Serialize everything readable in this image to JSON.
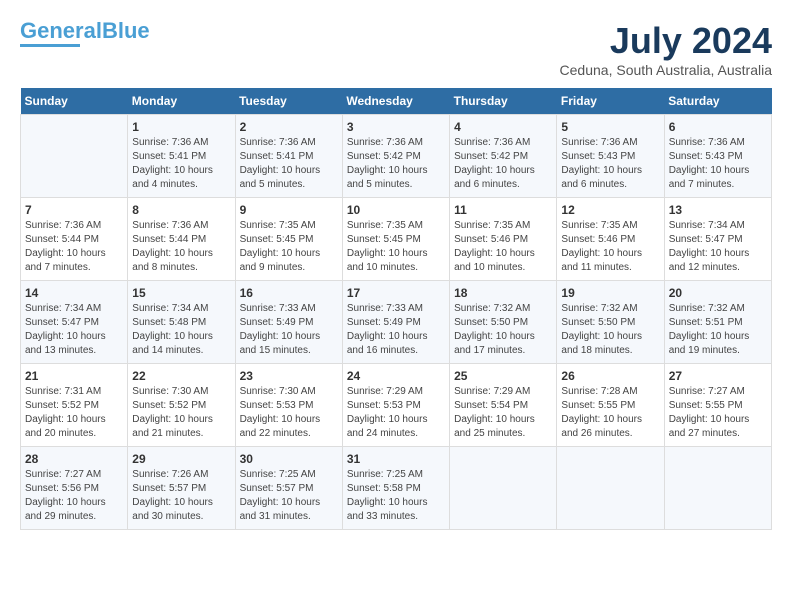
{
  "logo": {
    "general": "General",
    "blue": "Blue"
  },
  "title": "July 2024",
  "location": "Ceduna, South Australia, Australia",
  "days_of_week": [
    "Sunday",
    "Monday",
    "Tuesday",
    "Wednesday",
    "Thursday",
    "Friday",
    "Saturday"
  ],
  "weeks": [
    [
      {
        "day": "",
        "info": ""
      },
      {
        "day": "1",
        "info": "Sunrise: 7:36 AM\nSunset: 5:41 PM\nDaylight: 10 hours\nand 4 minutes."
      },
      {
        "day": "2",
        "info": "Sunrise: 7:36 AM\nSunset: 5:41 PM\nDaylight: 10 hours\nand 5 minutes."
      },
      {
        "day": "3",
        "info": "Sunrise: 7:36 AM\nSunset: 5:42 PM\nDaylight: 10 hours\nand 5 minutes."
      },
      {
        "day": "4",
        "info": "Sunrise: 7:36 AM\nSunset: 5:42 PM\nDaylight: 10 hours\nand 6 minutes."
      },
      {
        "day": "5",
        "info": "Sunrise: 7:36 AM\nSunset: 5:43 PM\nDaylight: 10 hours\nand 6 minutes."
      },
      {
        "day": "6",
        "info": "Sunrise: 7:36 AM\nSunset: 5:43 PM\nDaylight: 10 hours\nand 7 minutes."
      }
    ],
    [
      {
        "day": "7",
        "info": "Sunrise: 7:36 AM\nSunset: 5:44 PM\nDaylight: 10 hours\nand 7 minutes."
      },
      {
        "day": "8",
        "info": "Sunrise: 7:36 AM\nSunset: 5:44 PM\nDaylight: 10 hours\nand 8 minutes."
      },
      {
        "day": "9",
        "info": "Sunrise: 7:35 AM\nSunset: 5:45 PM\nDaylight: 10 hours\nand 9 minutes."
      },
      {
        "day": "10",
        "info": "Sunrise: 7:35 AM\nSunset: 5:45 PM\nDaylight: 10 hours\nand 10 minutes."
      },
      {
        "day": "11",
        "info": "Sunrise: 7:35 AM\nSunset: 5:46 PM\nDaylight: 10 hours\nand 10 minutes."
      },
      {
        "day": "12",
        "info": "Sunrise: 7:35 AM\nSunset: 5:46 PM\nDaylight: 10 hours\nand 11 minutes."
      },
      {
        "day": "13",
        "info": "Sunrise: 7:34 AM\nSunset: 5:47 PM\nDaylight: 10 hours\nand 12 minutes."
      }
    ],
    [
      {
        "day": "14",
        "info": "Sunrise: 7:34 AM\nSunset: 5:47 PM\nDaylight: 10 hours\nand 13 minutes."
      },
      {
        "day": "15",
        "info": "Sunrise: 7:34 AM\nSunset: 5:48 PM\nDaylight: 10 hours\nand 14 minutes."
      },
      {
        "day": "16",
        "info": "Sunrise: 7:33 AM\nSunset: 5:49 PM\nDaylight: 10 hours\nand 15 minutes."
      },
      {
        "day": "17",
        "info": "Sunrise: 7:33 AM\nSunset: 5:49 PM\nDaylight: 10 hours\nand 16 minutes."
      },
      {
        "day": "18",
        "info": "Sunrise: 7:32 AM\nSunset: 5:50 PM\nDaylight: 10 hours\nand 17 minutes."
      },
      {
        "day": "19",
        "info": "Sunrise: 7:32 AM\nSunset: 5:50 PM\nDaylight: 10 hours\nand 18 minutes."
      },
      {
        "day": "20",
        "info": "Sunrise: 7:32 AM\nSunset: 5:51 PM\nDaylight: 10 hours\nand 19 minutes."
      }
    ],
    [
      {
        "day": "21",
        "info": "Sunrise: 7:31 AM\nSunset: 5:52 PM\nDaylight: 10 hours\nand 20 minutes."
      },
      {
        "day": "22",
        "info": "Sunrise: 7:30 AM\nSunset: 5:52 PM\nDaylight: 10 hours\nand 21 minutes."
      },
      {
        "day": "23",
        "info": "Sunrise: 7:30 AM\nSunset: 5:53 PM\nDaylight: 10 hours\nand 22 minutes."
      },
      {
        "day": "24",
        "info": "Sunrise: 7:29 AM\nSunset: 5:53 PM\nDaylight: 10 hours\nand 24 minutes."
      },
      {
        "day": "25",
        "info": "Sunrise: 7:29 AM\nSunset: 5:54 PM\nDaylight: 10 hours\nand 25 minutes."
      },
      {
        "day": "26",
        "info": "Sunrise: 7:28 AM\nSunset: 5:55 PM\nDaylight: 10 hours\nand 26 minutes."
      },
      {
        "day": "27",
        "info": "Sunrise: 7:27 AM\nSunset: 5:55 PM\nDaylight: 10 hours\nand 27 minutes."
      }
    ],
    [
      {
        "day": "28",
        "info": "Sunrise: 7:27 AM\nSunset: 5:56 PM\nDaylight: 10 hours\nand 29 minutes."
      },
      {
        "day": "29",
        "info": "Sunrise: 7:26 AM\nSunset: 5:57 PM\nDaylight: 10 hours\nand 30 minutes."
      },
      {
        "day": "30",
        "info": "Sunrise: 7:25 AM\nSunset: 5:57 PM\nDaylight: 10 hours\nand 31 minutes."
      },
      {
        "day": "31",
        "info": "Sunrise: 7:25 AM\nSunset: 5:58 PM\nDaylight: 10 hours\nand 33 minutes."
      },
      {
        "day": "",
        "info": ""
      },
      {
        "day": "",
        "info": ""
      },
      {
        "day": "",
        "info": ""
      }
    ]
  ]
}
